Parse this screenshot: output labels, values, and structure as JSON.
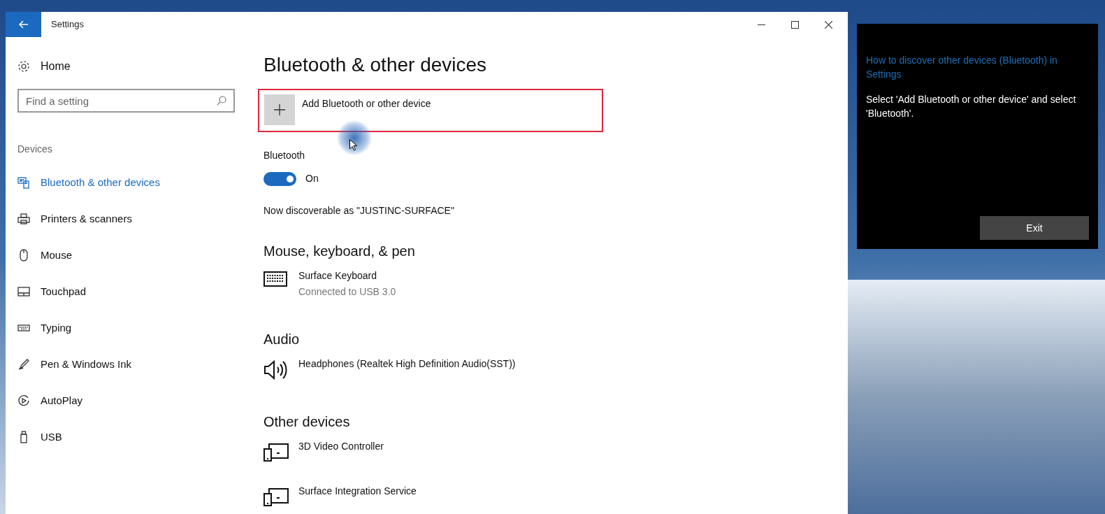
{
  "window": {
    "title": "Settings"
  },
  "sidebar": {
    "home": "Home",
    "search": {
      "placeholder": "Find a setting"
    },
    "section": "Devices",
    "items": [
      {
        "label": "Bluetooth & other devices",
        "selected": true
      },
      {
        "label": "Printers & scanners",
        "selected": false
      },
      {
        "label": "Mouse",
        "selected": false
      },
      {
        "label": "Touchpad",
        "selected": false
      },
      {
        "label": "Typing",
        "selected": false
      },
      {
        "label": "Pen & Windows Ink",
        "selected": false
      },
      {
        "label": "AutoPlay",
        "selected": false
      },
      {
        "label": "USB",
        "selected": false
      }
    ]
  },
  "page": {
    "title": "Bluetooth & other devices",
    "add_button": "Add Bluetooth or other device",
    "bluetooth": {
      "label": "Bluetooth",
      "on": true,
      "state": "On"
    },
    "discoverable": "Now discoverable as \"JUSTINC-SURFACE\"",
    "groups": [
      {
        "heading": "Mouse, keyboard, & pen",
        "devices": [
          {
            "kind": "keyboard",
            "name": "Surface Keyboard",
            "status": "Connected to USB 3.0"
          }
        ]
      },
      {
        "heading": "Audio",
        "devices": [
          {
            "kind": "audio",
            "name": "Headphones (Realtek High Definition Audio(SST))"
          }
        ]
      },
      {
        "heading": "Other devices",
        "devices": [
          {
            "kind": "other",
            "name": "3D Video Controller"
          },
          {
            "kind": "other",
            "name": "Surface Integration Service"
          }
        ]
      }
    ]
  },
  "tip_panel": {
    "title": "How to discover other devices (Bluetooth) in Settings",
    "text": "Select 'Add Bluetooth or other device' and select 'Bluetooth'.",
    "button": "Exit"
  }
}
